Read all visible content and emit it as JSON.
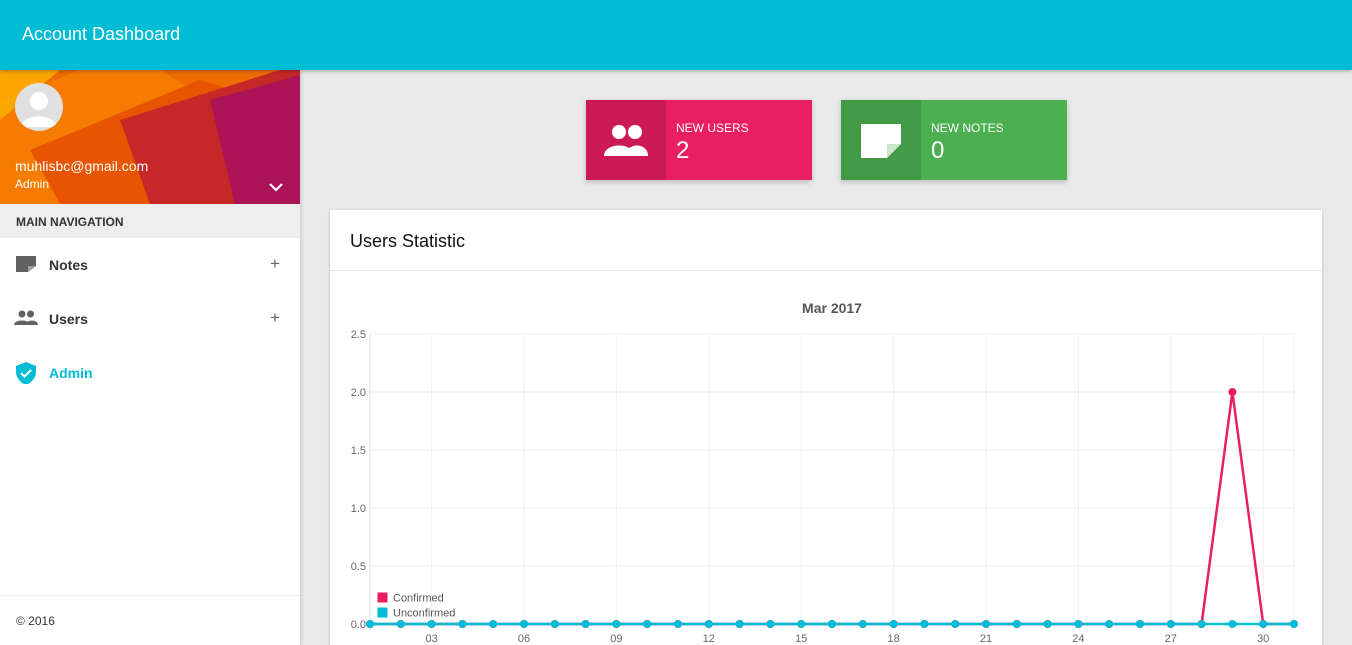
{
  "app": {
    "title": "Account Dashboard"
  },
  "user": {
    "email": "muhlisbc@gmail.com",
    "role": "Admin"
  },
  "nav": {
    "header": "MAIN NAVIGATION",
    "items": [
      {
        "label": "Notes",
        "icon": "note-icon",
        "expand": "+"
      },
      {
        "label": "Users",
        "icon": "people-icon",
        "expand": "+"
      },
      {
        "label": "Admin",
        "icon": "shield-check-icon",
        "active": true
      }
    ]
  },
  "footer": {
    "copyright": "© 2016"
  },
  "stats": {
    "users": {
      "label": "NEW USERS",
      "value": "2"
    },
    "notes": {
      "label": "NEW NOTES",
      "value": "0"
    }
  },
  "colors": {
    "primary": "#00bcd4",
    "pink": "#e91e63",
    "green": "#4caf50"
  },
  "card": {
    "title": "Users Statistic"
  },
  "chart_data": {
    "type": "line",
    "title": "Mar 2017",
    "xlabel": "",
    "ylabel": "",
    "ylim": [
      0,
      2.5
    ],
    "yticks": [
      "0.0",
      "0.5",
      "1.0",
      "1.5",
      "2.0",
      "2.5"
    ],
    "xticks": [
      "03",
      "06",
      "09",
      "12",
      "15",
      "18",
      "21",
      "24",
      "27",
      "30"
    ],
    "x": [
      1,
      2,
      3,
      4,
      5,
      6,
      7,
      8,
      9,
      10,
      11,
      12,
      13,
      14,
      15,
      16,
      17,
      18,
      19,
      20,
      21,
      22,
      23,
      24,
      25,
      26,
      27,
      28,
      29,
      30,
      31
    ],
    "legend": "bottom-left",
    "series": [
      {
        "name": "Confirmed",
        "color": "#e91e63",
        "values": [
          0,
          0,
          0,
          0,
          0,
          0,
          0,
          0,
          0,
          0,
          0,
          0,
          0,
          0,
          0,
          0,
          0,
          0,
          0,
          0,
          0,
          0,
          0,
          0,
          0,
          0,
          0,
          0,
          2,
          0,
          0
        ]
      },
      {
        "name": "Unconfirmed",
        "color": "#00bcd4",
        "values": [
          0,
          0,
          0,
          0,
          0,
          0,
          0,
          0,
          0,
          0,
          0,
          0,
          0,
          0,
          0,
          0,
          0,
          0,
          0,
          0,
          0,
          0,
          0,
          0,
          0,
          0,
          0,
          0,
          0,
          0,
          0
        ]
      }
    ]
  }
}
